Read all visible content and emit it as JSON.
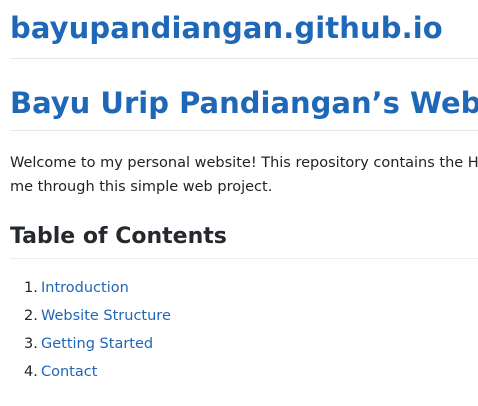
{
  "header": {
    "site_title": "bayupandiangan.github.io"
  },
  "main": {
    "title": "Bayu Urip Pandiangan’s Website",
    "intro_line_1": "Welcome to my personal website! This repository contains the HTML",
    "intro_line_2": "me through this simple web project.",
    "toc_heading": "Table of Contents",
    "toc": [
      {
        "number": "1.",
        "label": "Introduction"
      },
      {
        "number": "2.",
        "label": "Website Structure"
      },
      {
        "number": "3.",
        "label": "Getting Started"
      },
      {
        "number": "4.",
        "label": "Contact"
      }
    ]
  },
  "colors": {
    "link": "#2066b8",
    "heading": "#1f68b8",
    "text": "#222222",
    "rule": "#e6e8ea"
  }
}
